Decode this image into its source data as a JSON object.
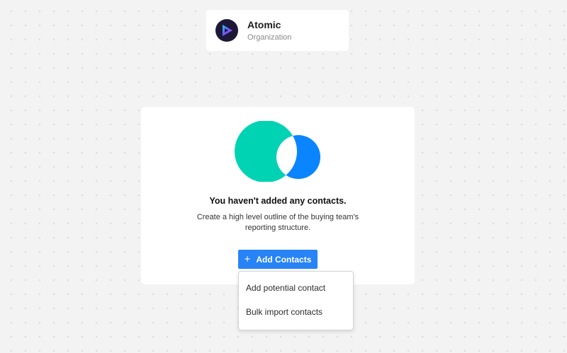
{
  "org": {
    "name": "Atomic",
    "subtitle": "Organization",
    "logo_icon": "play-gradient-icon"
  },
  "empty_state": {
    "title": "You haven't added any contacts.",
    "description": "Create a high level outline of the buying team's reporting structure.",
    "illustration": "overlapping-circles-icon",
    "illustration_colors": [
      "#00d3b4",
      "#0a84ff"
    ]
  },
  "add_button": {
    "label": "Add Contacts",
    "icon": "plus-icon",
    "color": "#2783f6"
  },
  "dropdown": {
    "items": [
      {
        "label": "Add potential contact"
      },
      {
        "label": "Bulk import contacts"
      }
    ]
  }
}
